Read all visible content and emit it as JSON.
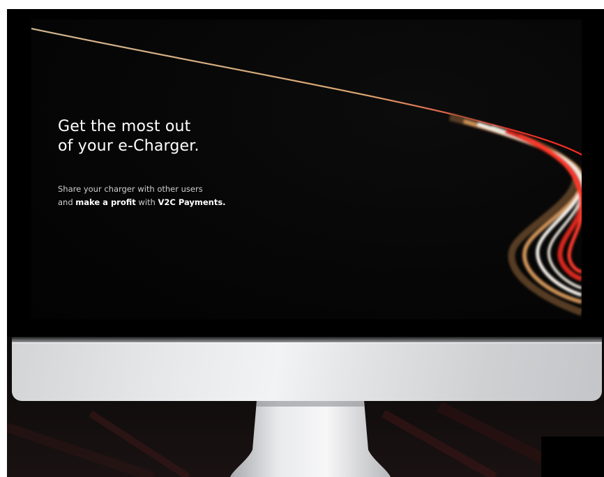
{
  "hero": {
    "headline_line1": "Get the most out",
    "headline_line2": "of your e-Charger.",
    "sub_line1": "Share your charger with other users",
    "sub_line2_pre": "and ",
    "sub_line2_bold1": "make a profit",
    "sub_line2_mid": " with ",
    "sub_line2_bold2": "V2C Payments."
  },
  "colors": {
    "screen_background": "#050505",
    "headline_text": "#ffffff",
    "body_text": "#cfcfcf",
    "light_trail_red": "#d11a16",
    "light_trail_white": "#f4f1ea",
    "light_trail_amber": "#b98a52",
    "monitor_silver": "#e6e7e9"
  },
  "icons": {
    "monitor": "imac-monitor-icon",
    "stand": "monitor-stand-icon"
  }
}
